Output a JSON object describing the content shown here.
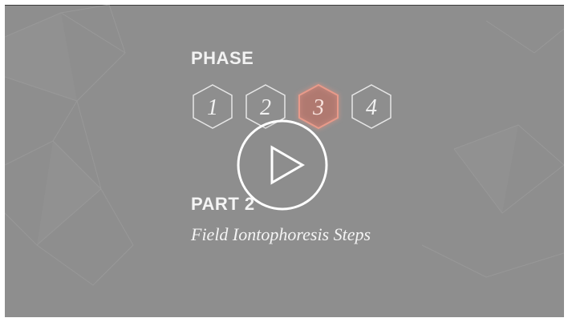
{
  "video": {
    "phase_heading": "PHASE",
    "phases": [
      {
        "label": "1",
        "active": false
      },
      {
        "label": "2",
        "active": false
      },
      {
        "label": "3",
        "active": true
      },
      {
        "label": "4",
        "active": false
      }
    ],
    "part_heading": "PART 2",
    "part_subtitle": "Field Iontophoresis Steps",
    "play_icon": "play-icon"
  },
  "colors": {
    "background": "#8e8e8e",
    "text": "#f2f2f2",
    "hex_stroke": "#e6e6e6",
    "active_hex_stroke": "#e89a8a",
    "active_hex_glow": "#d9614f",
    "active_hex_fill": "#c86a5c",
    "play_circle": "#ffffff"
  }
}
